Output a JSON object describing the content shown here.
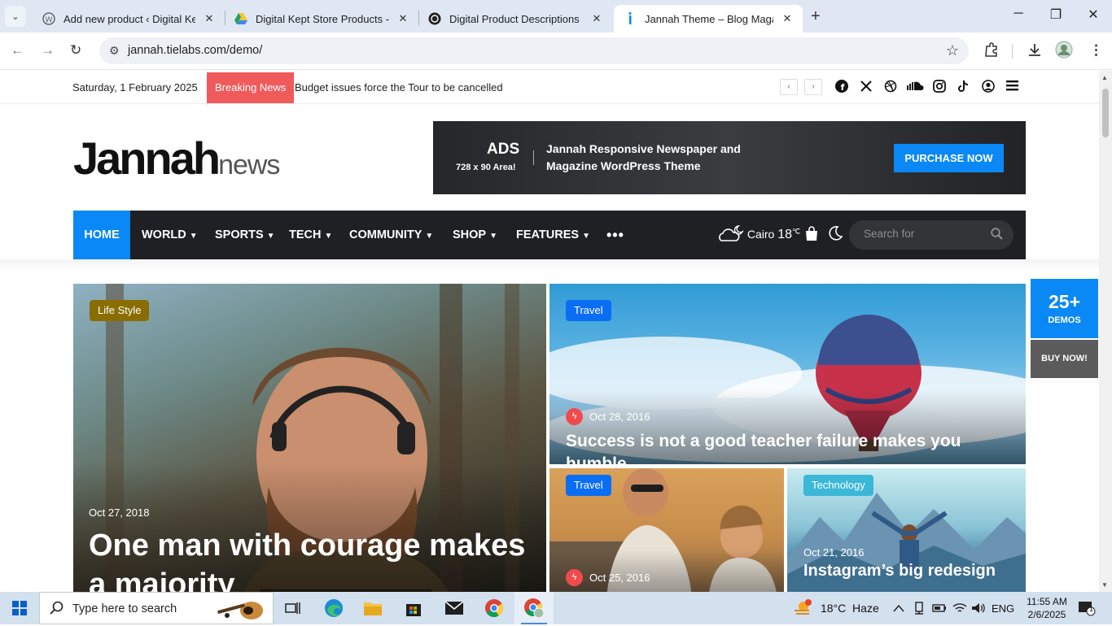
{
  "browser": {
    "tabs": [
      {
        "title": "Add new product ‹ Digital Kept Store",
        "icon": "wordpress-icon"
      },
      {
        "title": "Digital Kept Store Products - Google Drive",
        "icon": "google-drive-icon"
      },
      {
        "title": "Digital Product Descriptions Help",
        "icon": "chatgpt-icon"
      },
      {
        "title": "Jannah Theme – Blog Magazine",
        "icon": "jannah-icon",
        "active": true
      }
    ],
    "new_tab": "+",
    "url": "jannah.tielabs.com/demo/"
  },
  "site": {
    "date": "Saturday, 1 February 2025",
    "breaking_label": "Breaking News",
    "ticker": "Budget issues force the Tour to be cancelled",
    "social_icons": [
      "facebook-icon",
      "x-icon",
      "dribbble-icon",
      "soundcloud-icon",
      "instagram-icon",
      "tiktok-icon",
      "user-icon",
      "menu-icon"
    ],
    "logo": {
      "main": "Jannah",
      "sub": "news"
    },
    "ad": {
      "title": "ADS",
      "size": "728 x 90 Area!",
      "text": "Jannah Responsive Newspaper and Magazine WordPress Theme",
      "button": "PURCHASE NOW"
    },
    "nav": {
      "items": [
        "HOME",
        "WORLD",
        "SPORTS",
        "TECH",
        "COMMUNITY",
        "SHOP",
        "FEATURES"
      ],
      "more": "•••",
      "weather": {
        "city": "Cairo",
        "temp": "18",
        "unit": "℃"
      },
      "search_placeholder": "Search for"
    },
    "featured": [
      {
        "category": "Life Style",
        "date": "Oct 27, 2018",
        "title": "One man with courage makes a majority",
        "badge_color": "#8a6d00"
      },
      {
        "category": "Travel",
        "date": "Oct 28, 2016",
        "title": "Success is not a good teacher failure makes you humble",
        "badge_color": "#0a6ef5"
      },
      {
        "category": "Travel",
        "date": "Oct 25, 2016",
        "title": "",
        "badge_color": "#0a6ef5"
      },
      {
        "category": "Technology",
        "date": "Oct 21, 2016",
        "title": "Instagram’s big redesign",
        "badge_color": "#3bb7d8"
      }
    ],
    "demos": {
      "count": "25+",
      "label": "DEMOS",
      "buy": "BUY NOW!"
    }
  },
  "taskbar": {
    "search_placeholder": "Type here to search",
    "weather": "18°C  Haze",
    "lang": "ENG",
    "time": "11:55 AM",
    "date": "2/6/2025",
    "notifications": "1"
  }
}
